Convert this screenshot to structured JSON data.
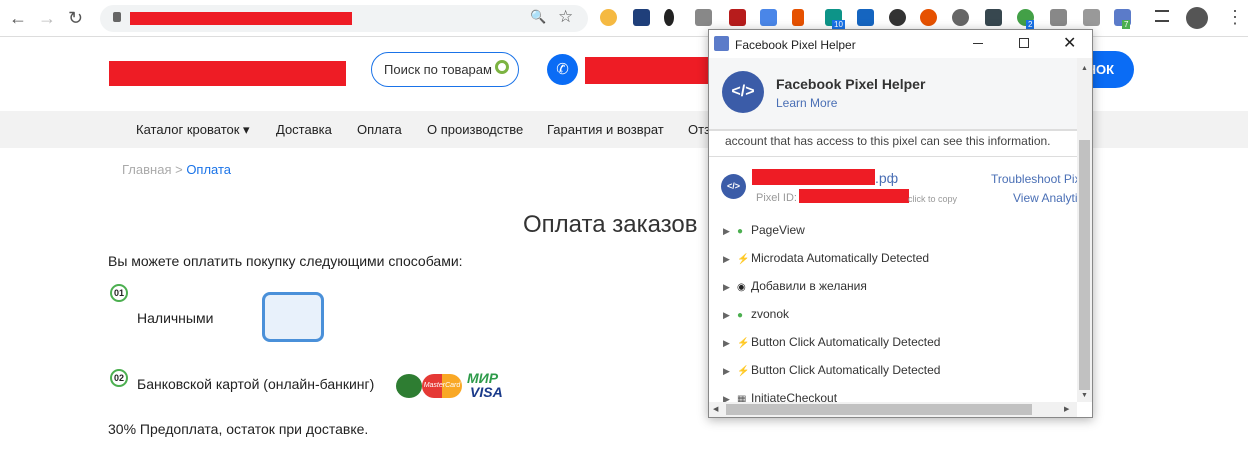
{
  "browser": {
    "back": "←",
    "forward": "→",
    "reload": "↻",
    "zoom_icon": "🔍",
    "star": "☆",
    "menu": "⋮",
    "ext_badges": [
      "10",
      "2",
      "7"
    ]
  },
  "site": {
    "search_placeholder": "Поиск по товарам",
    "call_button": "нок",
    "nav": [
      "Каталог кроваток ▾",
      "Доставка",
      "Оплата",
      "О производстве",
      "Гарантия и возврат",
      "Отз"
    ],
    "breadcrumb": {
      "home": "Главная",
      "sep": " > ",
      "current": "Оплата"
    },
    "title": "Оплата заказов",
    "intro": "Вы можете оплатить покупку следующими способами:",
    "methods": [
      {
        "num": "01",
        "label": "Наличными"
      },
      {
        "num": "02",
        "label": "Банковской картой (онлайн-банкинг)"
      }
    ],
    "cards": [
      "MasterCard",
      "МИР",
      "VISA"
    ],
    "note": "30% Предоплата, остаток при доставке."
  },
  "popup": {
    "window_title": "Facebook Pixel Helper",
    "app_name": "Facebook Pixel Helper",
    "learn_more": "Learn More",
    "info": "account that has access to this pixel can see this information.",
    "domain_suffix": ".рф",
    "pixel_id_label": "Pixel ID:",
    "click_to_copy": "click to copy",
    "troubleshoot": "Troubleshoot Pixel",
    "view_analytics": "View Analytics",
    "events": [
      {
        "name": "PageView",
        "icon": "check",
        "color": "#4caf50"
      },
      {
        "name": "Microdata Automatically Detected",
        "icon": "bolt",
        "color": "#4a7bd0"
      },
      {
        "name": "Добавили в желания",
        "icon": "circle",
        "color": "#222"
      },
      {
        "name": "zvonok",
        "icon": "check",
        "color": "#4caf50"
      },
      {
        "name": "Button Click Automatically Detected",
        "icon": "bolt",
        "color": "#4a7bd0"
      },
      {
        "name": "Button Click Automatically Detected",
        "icon": "bolt",
        "color": "#4a7bd0"
      },
      {
        "name": "InitiateCheckout",
        "icon": "grid",
        "color": "#555"
      }
    ]
  }
}
